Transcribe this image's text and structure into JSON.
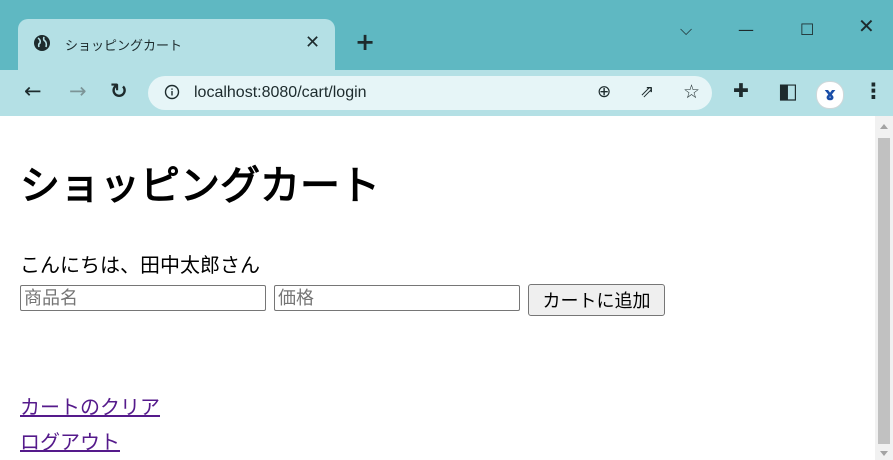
{
  "browser": {
    "tab": {
      "title": "ショッピングカート",
      "icon": "globe-icon"
    },
    "new_tab_glyph": "+",
    "url": "localhost:8080/cart/login",
    "colors": {
      "frame": "#5fb8c2",
      "toolbar": "#b4e0e5",
      "omnibox": "#e6f5f7"
    }
  },
  "page": {
    "title": "ショッピングカート",
    "greeting": "こんにちは、田中太郎さん",
    "form": {
      "name_placeholder": "商品名",
      "price_placeholder": "価格",
      "add_label": "カートに追加"
    },
    "links": {
      "clear_cart": "カートのクリア",
      "logout": "ログアウト"
    },
    "colors": {
      "visited_link": "#551a8b"
    }
  }
}
